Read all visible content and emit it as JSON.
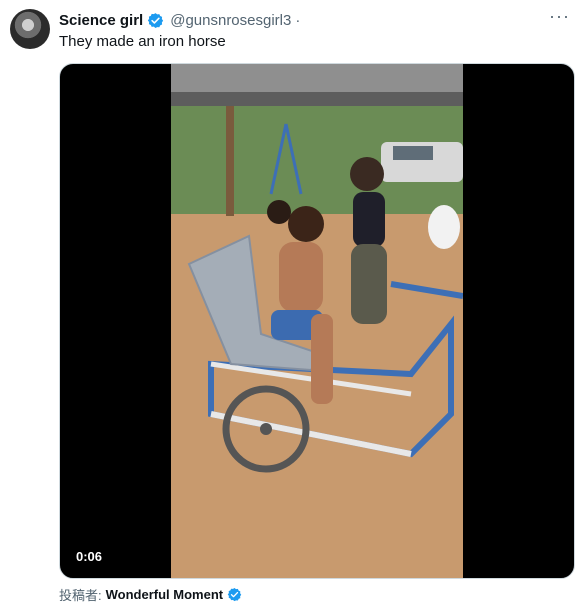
{
  "tweet": {
    "author_name": "Science girl",
    "handle": "@gunsnrosesgirl3",
    "separator": "·",
    "text": "They made an iron horse",
    "more_icon": "···"
  },
  "media": {
    "duration": "0:06"
  },
  "attribution": {
    "label": "投稿者:",
    "source_name": "Wonderful Moment"
  },
  "colors": {
    "verified_blue": "#1d9bf0",
    "secondary_text": "#536471"
  }
}
